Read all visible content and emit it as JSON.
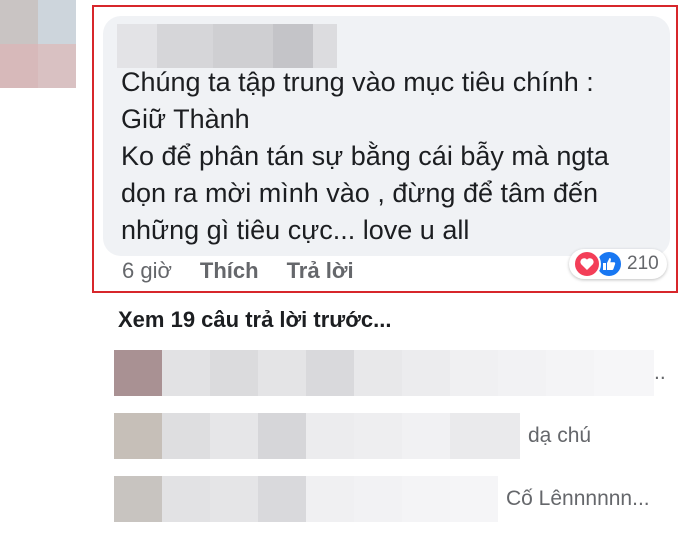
{
  "comment": {
    "text_lines": [
      "Chúng ta tập trung vào mục tiêu chính :",
      "Giữ Thành",
      "Ko để phân tán sự bằng cái bẫy mà ngta",
      "dọn ra mời mình vào , đừng để tâm đến",
      "những gì tiêu cực... love u all"
    ],
    "time": "6 giờ",
    "like_action": "Thích",
    "reply_action": "Trả lời",
    "reaction_count": "210",
    "reaction_icons": [
      "love-icon",
      "like-icon"
    ]
  },
  "view_previous": "Xem 19 câu trả lời trước...",
  "replies": [
    {
      "text": ".."
    },
    {
      "text": "dạ chú"
    },
    {
      "text": "Cố Lênnnnnn..."
    }
  ],
  "colors": {
    "highlight_border": "#d7262b",
    "bubble_bg": "#f0f2f5",
    "love": "#f33e58",
    "like": "#1877f2",
    "meta_text": "#65676b"
  }
}
